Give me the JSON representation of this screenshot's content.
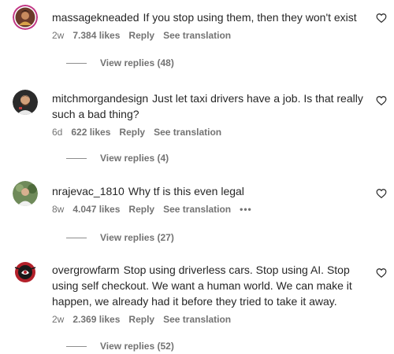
{
  "heart_icon": "heart-outline-icon",
  "comments": [
    {
      "username": "massagekneaded",
      "text": "If you stop using them, then they won't exist",
      "age": "2w",
      "likes": "7.384 likes",
      "reply": "Reply",
      "translate": "See translation",
      "more": "",
      "view_replies": "View replies (48)"
    },
    {
      "username": "mitchmorgandesign",
      "text": "Just let taxi drivers have a job. Is that really such a bad thing?",
      "age": "6d",
      "likes": "622 likes",
      "reply": "Reply",
      "translate": "See translation",
      "more": "",
      "view_replies": "View replies (4)"
    },
    {
      "username": "nrajevac_1810",
      "text": "Why tf is this even legal",
      "age": "8w",
      "likes": "4.047 likes",
      "reply": "Reply",
      "translate": "See translation",
      "more": "•••",
      "view_replies": "View replies (27)"
    },
    {
      "username": "overgrowfarm",
      "text": "Stop using driverless cars. Stop using AI. Stop using self checkout. We want a human world. We can make it happen, we already had it before they tried to take it away.",
      "age": "2w",
      "likes": "2.369 likes",
      "reply": "Reply",
      "translate": "See translation",
      "more": "",
      "view_replies": "View replies (52)"
    }
  ]
}
